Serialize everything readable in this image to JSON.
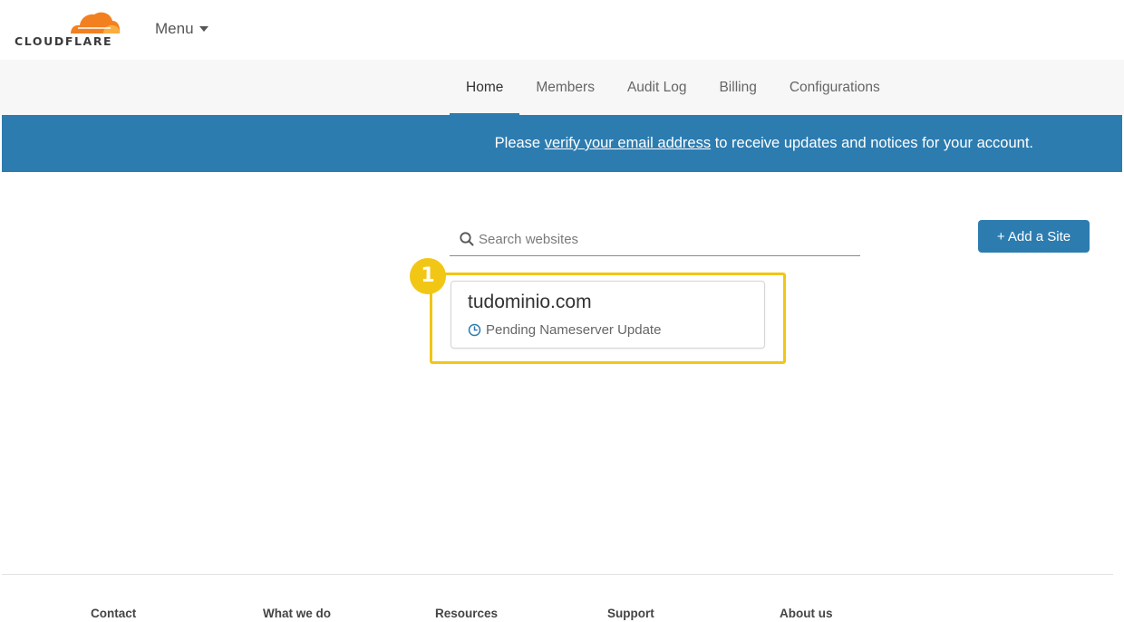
{
  "brand": {
    "logo_text": "CLOUDFLARE",
    "logo_icon": "cloud-icon",
    "colors": {
      "orange": "#f38020",
      "light_orange": "#faae40"
    }
  },
  "header": {
    "menu_label": "Menu"
  },
  "nav": {
    "tabs": [
      {
        "label": "Home",
        "active": true
      },
      {
        "label": "Members"
      },
      {
        "label": "Audit Log"
      },
      {
        "label": "Billing"
      },
      {
        "label": "Configurations"
      }
    ]
  },
  "banner": {
    "prefix": "Please ",
    "link_text": "verify your email address",
    "suffix": " to receive updates and notices for your account.",
    "color": "#2c7cb0"
  },
  "search": {
    "placeholder": "Search websites",
    "value": ""
  },
  "actions": {
    "add_site_label": "+ Add a Site"
  },
  "annotation": {
    "step_number": "1",
    "color": "#f2c614"
  },
  "sites": [
    {
      "name": "tudominio.com",
      "status": "Pending Nameserver Update"
    }
  ],
  "footer": {
    "columns": [
      "Contact",
      "What we do",
      "Resources",
      "Support",
      "About us"
    ]
  }
}
